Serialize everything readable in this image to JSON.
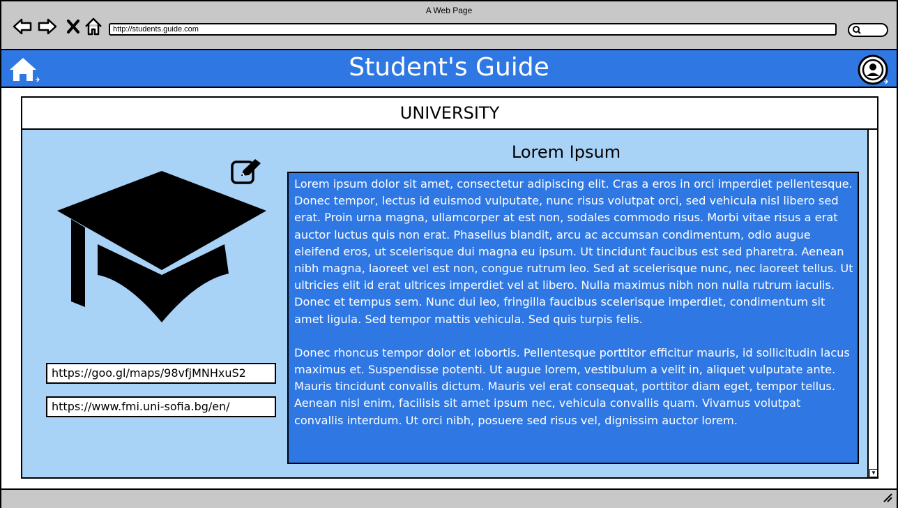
{
  "window": {
    "title": "A Web Page"
  },
  "browser": {
    "url": "http://students.guide.com"
  },
  "header": {
    "title": "Student's Guide"
  },
  "panel": {
    "title": "UNIVERSITY"
  },
  "links": {
    "maps": "https://goo.gl/maps/98vfjMNHxuS2",
    "site": "https://www.fmi.uni-sofia.bg/en/"
  },
  "article": {
    "title": "Lorem Ipsum",
    "paragraph1": "Lorem ipsum dolor sit amet, consectetur adipiscing elit. Cras a eros in orci imperdiet pellentesque. Donec tempor, lectus id euismod vulputate, nunc risus volutpat orci, sed vehicula nisl libero sed erat. Proin urna magna, ullamcorper at est non, sodales commodo risus. Morbi vitae risus a erat auctor luctus quis non erat. Phasellus blandit, arcu ac accumsan condimentum, odio augue eleifend eros, ut scelerisque dui magna eu ipsum. Ut tincidunt faucibus est sed pharetra. Aenean nibh magna, laoreet vel est non, congue rutrum leo. Sed at scelerisque nunc, nec laoreet tellus. Ut ultricies elit id erat ultrices imperdiet vel at libero. Nulla maximus nibh non nulla rutrum iaculis. Donec et tempus sem. Nunc dui leo, fringilla faucibus scelerisque imperdiet, condimentum sit amet ligula. Sed tempor mattis vehicula. Sed quis turpis felis.",
    "paragraph2": "Donec rhoncus tempor dolor et lobortis. Pellentesque porttitor efficitur mauris, id sollicitudin lacus maximus et. Suspendisse potenti. Ut augue lorem, vestibulum a velit in, aliquet vulputate ante. Mauris tincidunt convallis dictum. Mauris vel erat consequat, porttitor diam eget, tempor tellus. Aenean nisl enim, facilisis sit amet ipsum nec, vehicula convallis quam. Vivamus volutpat convallis interdum. Ut orci nibh, posuere sed risus vel, dignissim auctor lorem."
  },
  "icons": {
    "back": "back-arrow-icon",
    "forward": "forward-arrow-icon",
    "close": "close-icon",
    "home_nav": "home-icon",
    "search": "search-icon",
    "home_header": "home-icon",
    "profile": "user-profile-icon",
    "edit": "edit-icon",
    "graduation": "graduation-cap-icon"
  },
  "colors": {
    "chrome": "#c8c8c8",
    "header": "#2f78e4",
    "content_bg": "#a9d2f7",
    "text_box": "#2f78e4"
  }
}
